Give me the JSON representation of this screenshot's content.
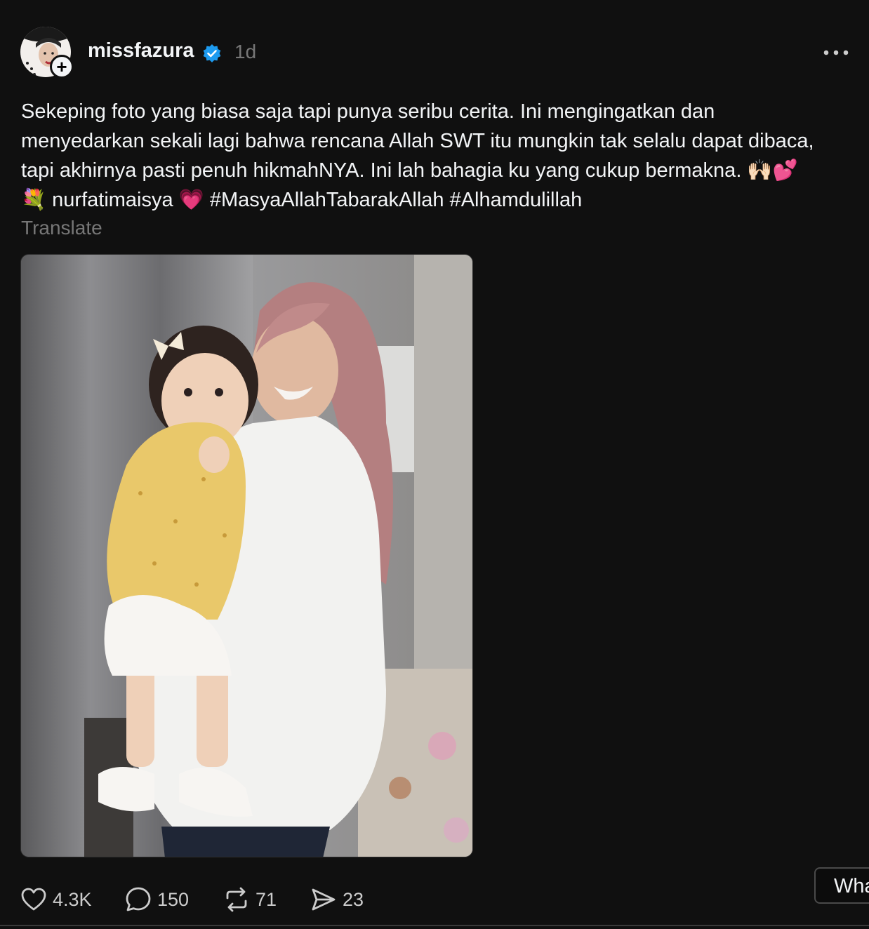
{
  "post": {
    "username": "missfazura",
    "timestamp": "1d",
    "caption": "Sekeping foto yang biasa saja tapi punya seribu cerita. Ini mengingatkan dan menyedarkan sekali lagi bahwa rencana Allah SWT itu mungkin tak selalu dapat dibaca, tapi akhirnya pasti penuh hikmahNYA. Ini lah bahagia ku yang cukup bermakna. 🙌🏻💕💐 nurfatimaisya 💗 #MasyaAllahTabarakAllah #Alhamdulillah",
    "translate_label": "Translate"
  },
  "actions": {
    "likes": "4.3K",
    "comments": "150",
    "reposts": "71",
    "shares": "23"
  },
  "partial_button_label": "Wha",
  "icons": {
    "avatar": "profile-avatar",
    "follow": "plus-icon",
    "verified": "verified-badge-icon",
    "more": "more-horizontal-icon",
    "like": "heart-icon",
    "comment": "comment-bubble-icon",
    "repost": "repost-icon",
    "share": "send-icon"
  },
  "colors": {
    "background": "#101010",
    "text": "#f3f5f7",
    "muted": "#777777",
    "verified": "#1d9bf0"
  }
}
